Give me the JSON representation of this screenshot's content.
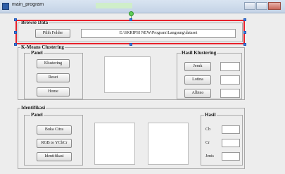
{
  "window": {
    "title": "main_program"
  },
  "browse": {
    "title": "Browse Data",
    "button": "Pilih Folder",
    "path": "E:\\SKRIPSI NEW\\Program\\Langsung\\dataset"
  },
  "kmeans": {
    "title": "K-Means Clustering",
    "panel_title": "Panel",
    "buttons": [
      "Klustering",
      "Reset",
      "Home"
    ],
    "result_title": "Hasil Klustering",
    "result_buttons": [
      "Jeruk",
      "Lotina",
      "Albino"
    ]
  },
  "identifikasi": {
    "title": "Identifikasi",
    "panel_title": "Panel",
    "buttons": [
      "Buka Citra",
      "RGB to YCbCr",
      "Identifikasi"
    ],
    "result_title": "Hasil",
    "labels": [
      "Cb",
      "Cr",
      "Jenis"
    ]
  },
  "colors": {
    "selection": "#e8212b",
    "handles": "#3c7be0",
    "rotate_handle": "#5fcf58"
  }
}
